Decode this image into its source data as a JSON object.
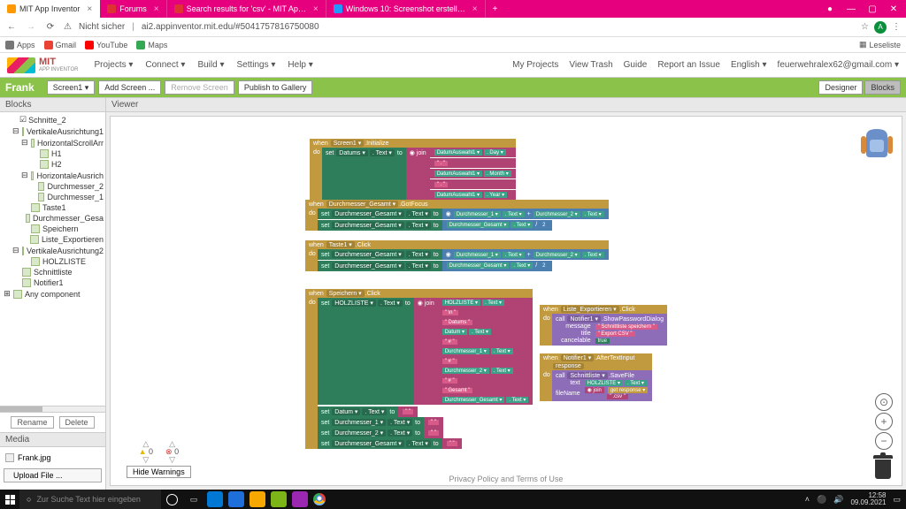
{
  "browser": {
    "tabs": [
      {
        "label": "MIT App Inventor",
        "active": true
      },
      {
        "label": "Forums",
        "active": false
      },
      {
        "label": "Search results for 'csv' - MIT Ap…",
        "active": false
      },
      {
        "label": "Windows 10: Screenshot erstell…",
        "active": false
      }
    ],
    "insecure": "Nicht sicher",
    "url": "ai2.appinventor.mit.edu/#5041757816750080",
    "leseliste": "Leseliste",
    "bookmarks": {
      "apps": "Apps",
      "gmail": "Gmail",
      "youtube": "YouTube",
      "maps": "Maps"
    }
  },
  "app": {
    "brand": "MIT",
    "brand_sub": "APP INVENTOR",
    "menus": {
      "projects": "Projects ▾",
      "connect": "Connect ▾",
      "build": "Build ▾",
      "settings": "Settings ▾",
      "help": "Help ▾"
    },
    "right": {
      "my_projects": "My Projects",
      "view_trash": "View Trash",
      "guide": "Guide",
      "report": "Report an Issue",
      "lang": "English ▾",
      "email": "feuerwehralex62@gmail.com ▾"
    }
  },
  "project": {
    "name": "Frank",
    "btns": {
      "screen": "Screen1 ▾",
      "add": "Add Screen ...",
      "remove": "Remove Screen",
      "publish": "Publish to Gallery",
      "designer": "Designer",
      "blocks": "Blocks"
    }
  },
  "panels": {
    "blocks": "Blocks",
    "viewer": "Viewer",
    "media": "Media"
  },
  "tree": {
    "items": [
      {
        "label": "Schnitte_2",
        "indent": 1,
        "checkbox": true
      },
      {
        "label": "VertikaleAusrichtung1",
        "indent": 1,
        "toggle": "⊟"
      },
      {
        "label": "HorizontalScrollArr",
        "indent": 2,
        "toggle": "⊟"
      },
      {
        "label": "H1",
        "indent": 3
      },
      {
        "label": "H2",
        "indent": 3
      },
      {
        "label": "HorizontaleAusrich",
        "indent": 2,
        "toggle": "⊟"
      },
      {
        "label": "Durchmesser_2",
        "indent": 3
      },
      {
        "label": "Durchmesser_1",
        "indent": 3
      },
      {
        "label": "Taste1",
        "indent": 2
      },
      {
        "label": "Durchmesser_Gesa",
        "indent": 2
      },
      {
        "label": "Speichern",
        "indent": 2
      },
      {
        "label": "Liste_Exportieren",
        "indent": 2
      },
      {
        "label": "VertikaleAusrichtung2",
        "indent": 1,
        "toggle": "⊟"
      },
      {
        "label": "HOLZLISTE",
        "indent": 2
      },
      {
        "label": "Schnittliste",
        "indent": 1
      },
      {
        "label": "Notifier1",
        "indent": 1
      },
      {
        "label": "Any component",
        "indent": 0,
        "toggle": "⊞"
      }
    ],
    "actions": {
      "rename": "Rename",
      "delete": "Delete"
    }
  },
  "media": {
    "file": "Frank.jpg",
    "upload": "Upload File ..."
  },
  "canvas": {
    "warn_count": "0",
    "err_count": "0",
    "hide_warnings": "Hide Warnings",
    "footer": "Privacy Policy and Terms of Use"
  },
  "blocks": {
    "b1": {
      "when": "when",
      "comp": "Screen1 ▾",
      "evt": ".Initialize",
      "do": "do",
      "set": "set",
      "targ": "Datums ▾",
      "prop": ". Text ▾",
      "to": "to",
      "join": "join",
      "r1a": "DatumAuswahl1 ▾",
      "r1b": ". Day ▾",
      "r2a": "DatumAuswahl1 ▾",
      "r2b": ". Month ▾",
      "r3a": "DatumAuswahl1 ▾",
      "r3b": ". Year ▾"
    },
    "b2": {
      "when": "when",
      "comp": "Durchmesser_Gesamt ▾",
      "evt": ".GotFocus",
      "do": "do",
      "set": "set",
      "targ": "Durchmesser_Gesamt ▾",
      "prop": ". Text ▾",
      "to": "to",
      "m1": "Durchmesser_1 ▾",
      "m1p": ". Text ▾",
      "plus": "+",
      "m2": "Durchmesser_2 ▾",
      "m2p": ". Text ▾",
      "div": "/",
      "two": "2"
    },
    "b3": {
      "when": "when",
      "comp": "Taste1 ▾",
      "evt": ".Click",
      "do": "do",
      "set": "set",
      "targ": "Durchmesser_Gesamt ▾",
      "prop": ". Text ▾",
      "to": "to"
    },
    "b4": {
      "when": "when",
      "comp": "Speichern ▾",
      "evt": ".Click",
      "do": "do",
      "set": "set",
      "targ": "HOLZLISTE ▾",
      "prop": ". Text ▾",
      "to": "to",
      "join": "join",
      "r1": "HOLZLISTE ▾",
      "r1p": ". Text ▾",
      "br": "\\n",
      "r2": "Datums",
      "r3": "Datum ▾",
      "r3p": ". Text ▾",
      "r4": "Durchmesser_1 ▾",
      "r5": "Durchmesser_2 ▾",
      "r6": "Gesamt",
      "r7": "Durchmesser_Gesamt ▾",
      "s2": "Datum ▾",
      "s3": "Durchmesser_1 ▾",
      "s4": "Durchmesser_2 ▾"
    },
    "b5": {
      "when": "when",
      "comp": "Liste_Exportieren ▾",
      "evt": ".Click",
      "do": "do",
      "call": "call",
      "targ": "Notifier1 ▾",
      "meth": ".ShowPasswordDialog",
      "p1": "message",
      "v1": "Schnittliste speichern",
      "p2": "title",
      "v2": "Export CSV",
      "p3": "cancelable",
      "v3": "true"
    },
    "b6": {
      "when": "when",
      "comp": "Notifier1 ▾",
      "evt": ".AfterTextInput",
      "resp": "response",
      "do": "do",
      "call": "call",
      "targ": "Schnittliste ▾",
      "meth": ".SaveFile",
      "p1": "text",
      "v1": "HOLZLISTE ▾",
      "v1p": ". Text ▾",
      "p2": "fileName",
      "join": "join",
      "get": "get",
      "gr": "response ▾",
      "csv": ".csv"
    }
  },
  "taskbar": {
    "search": "Zur Suche Text hier eingeben",
    "time": "12:58",
    "date": "09.09.2021"
  }
}
